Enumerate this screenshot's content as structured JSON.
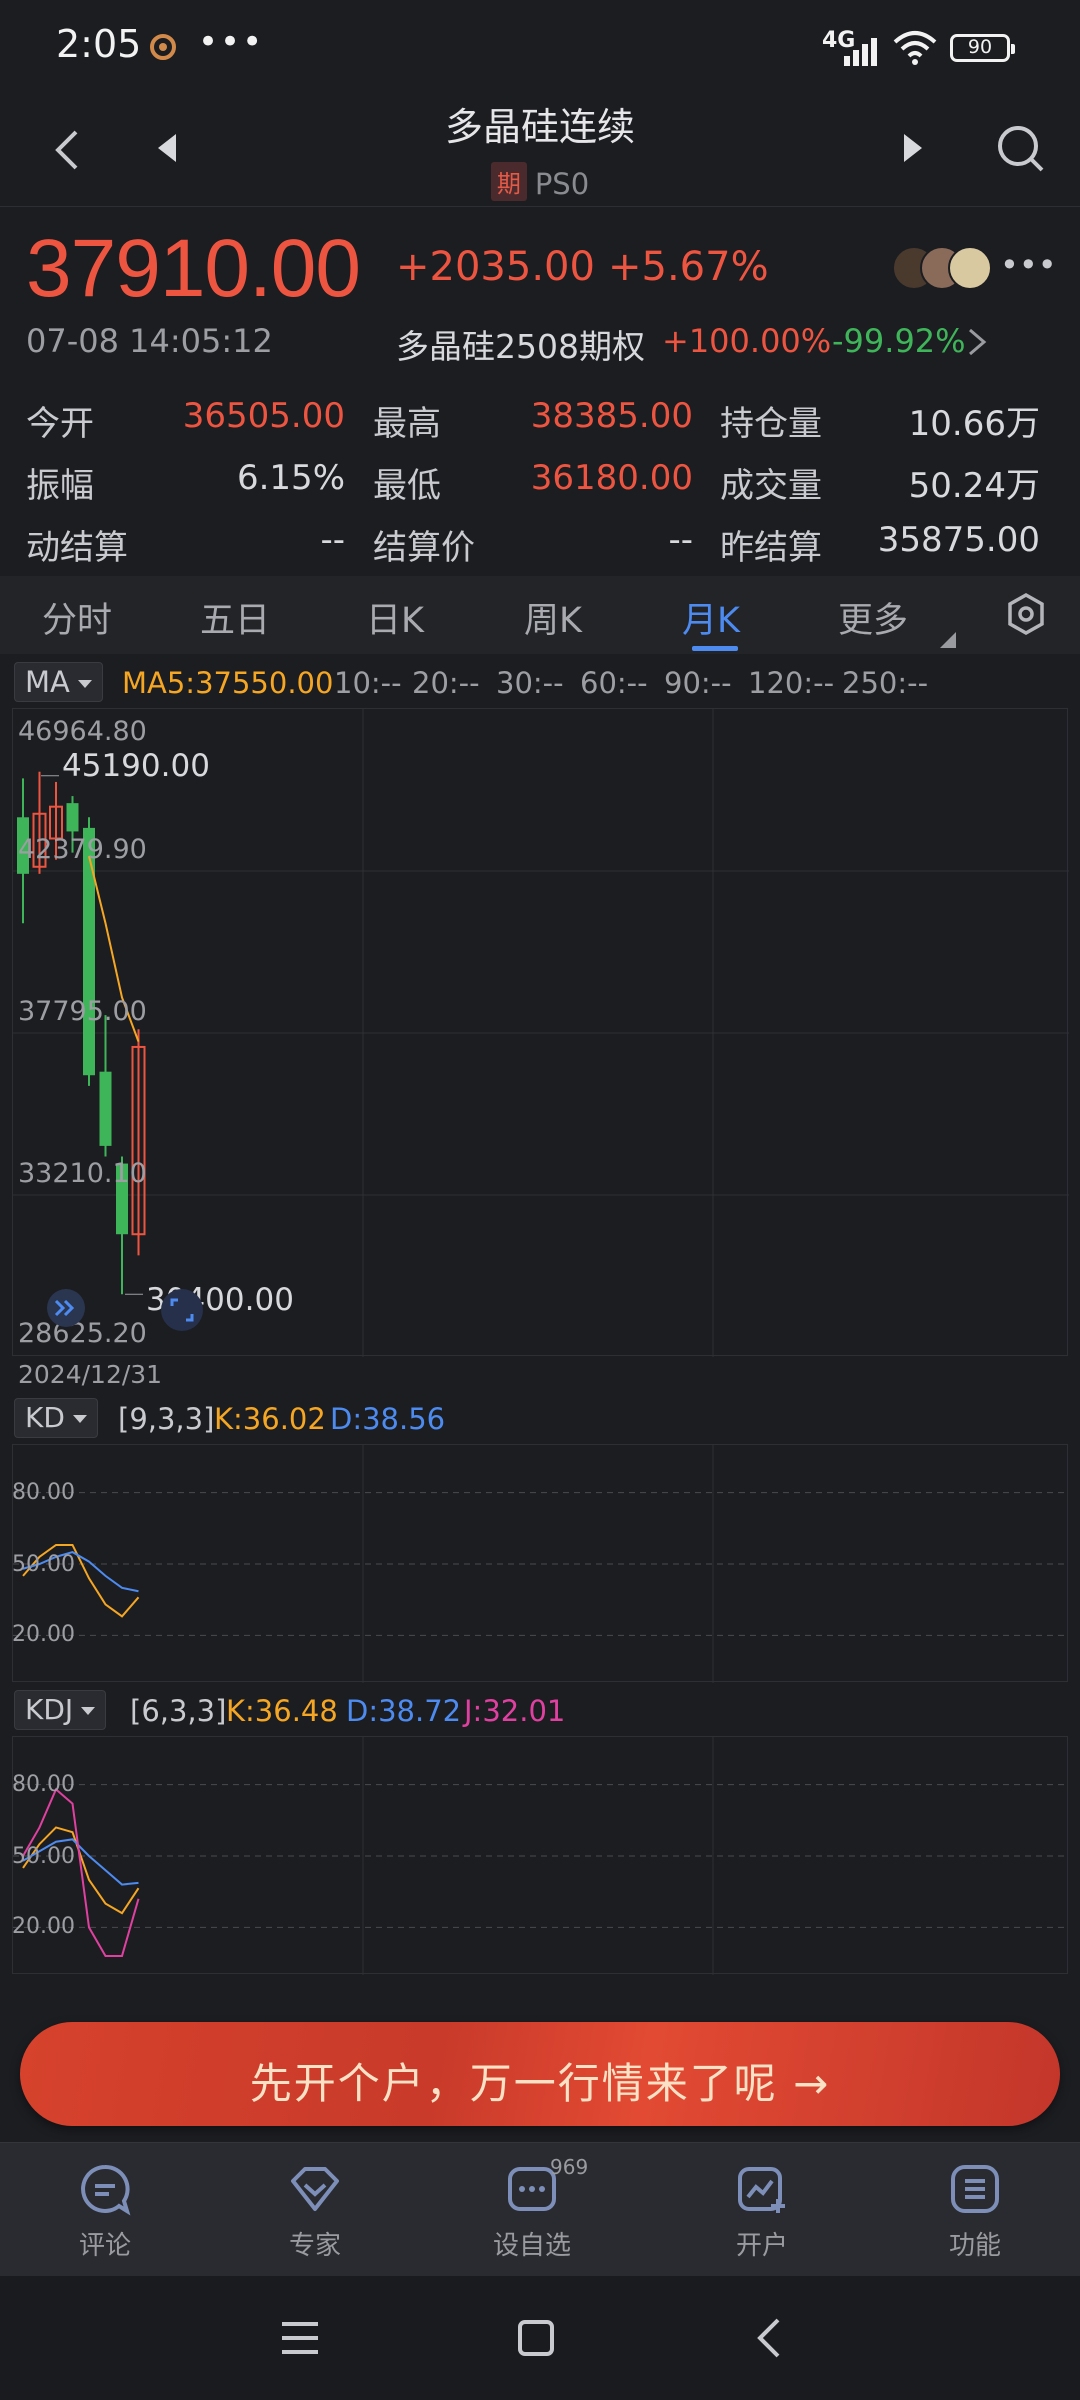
{
  "status_bar": {
    "time": "2:05",
    "dots": "•••",
    "signal": "4G",
    "battery": "90"
  },
  "header": {
    "title": "多晶硅连续",
    "badge": "期",
    "code": "PS0"
  },
  "quote": {
    "price": "37910.00",
    "change": "+2035.00",
    "change_pct": "+5.67%",
    "timestamp": "07-08 14:05:12",
    "option_name": "多晶硅2508期权",
    "option_up": "+100.00%",
    "option_down": "-99.92%"
  },
  "stats": [
    {
      "label": "今开",
      "value": "36505.00",
      "color": "#ee5541"
    },
    {
      "label": "最高",
      "value": "38385.00",
      "color": "#ee5541"
    },
    {
      "label": "持仓量",
      "value": "10.66万",
      "color": "#d8d9dd"
    },
    {
      "label": "振幅",
      "value": "6.15%",
      "color": "#d8d9dd"
    },
    {
      "label": "最低",
      "value": "36180.00",
      "color": "#ee5541"
    },
    {
      "label": "成交量",
      "value": "50.24万",
      "color": "#d8d9dd"
    },
    {
      "label": "动结算",
      "value": "--",
      "color": "#d8d9dd"
    },
    {
      "label": "结算价",
      "value": "--",
      "color": "#d8d9dd"
    },
    {
      "label": "昨结算",
      "value": "35875.00",
      "color": "#d8d9dd"
    }
  ],
  "tabs": [
    "分时",
    "五日",
    "日K",
    "周K",
    "月K",
    "更多"
  ],
  "active_tab": "月K",
  "ma_bar": {
    "selector": "MA",
    "ma5": "MA5:37550.00",
    "others": [
      "10:--",
      "20:--",
      "30:--",
      "60:--",
      "90:--",
      "120:--",
      "250:--"
    ]
  },
  "chart_data": [
    {
      "type": "candlestick",
      "title": "",
      "axis_labels": [
        "46964.80",
        "42379.90",
        "37795.00",
        "33210.10",
        "28625.20"
      ],
      "ylim": [
        28625.2,
        46964.8
      ],
      "start_date": "2024/12/31",
      "max_marker": "45190.00",
      "min_marker": "30400.00",
      "candles": [
        {
          "open": 42300,
          "close": 43900,
          "high": 45000,
          "low": 40900,
          "dir": "down"
        },
        {
          "open": 42500,
          "close": 44000,
          "high": 45190,
          "low": 42300,
          "dir": "up"
        },
        {
          "open": 43300,
          "close": 44200,
          "high": 44900,
          "low": 42700,
          "dir": "up"
        },
        {
          "open": 44300,
          "close": 43500,
          "high": 44500,
          "low": 42900,
          "dir": "down"
        },
        {
          "open": 43600,
          "close": 36600,
          "high": 43900,
          "low": 36300,
          "dir": "down"
        },
        {
          "open": 36700,
          "close": 34600,
          "high": 38300,
          "low": 34300,
          "dir": "down"
        },
        {
          "open": 34100,
          "close": 32100,
          "high": 34300,
          "low": 30400,
          "dir": "down"
        },
        {
          "open": 32100,
          "close": 37400,
          "high": 37900,
          "low": 31500,
          "dir": "up"
        }
      ],
      "ma5": [
        null,
        null,
        null,
        null,
        42800,
        40900,
        38800,
        37550
      ]
    },
    {
      "type": "line",
      "title": "KD",
      "params": "[9,3,3]",
      "legend": {
        "k": "K:36.02",
        "d": "D:38.56"
      },
      "axis_labels": [
        "80.00",
        "50.00",
        "20.00"
      ],
      "ylim": [
        0,
        100
      ],
      "series": [
        {
          "name": "K",
          "color": "#f5a623",
          "values": [
            45,
            53,
            58,
            58,
            44,
            33,
            28,
            36
          ]
        },
        {
          "name": "D",
          "color": "#4d8bf0",
          "values": [
            48,
            50,
            53,
            55,
            51,
            45,
            40,
            38.56
          ]
        }
      ]
    },
    {
      "type": "line",
      "title": "KDJ",
      "params": "[6,3,3]",
      "legend": {
        "k": "K:36.48",
        "d": "D:38.72",
        "j": "J:32.01"
      },
      "axis_labels": [
        "80.00",
        "50.00",
        "20.00"
      ],
      "ylim": [
        0,
        100
      ],
      "series": [
        {
          "name": "K",
          "color": "#f5a623",
          "values": [
            45,
            55,
            62,
            60,
            40,
            30,
            26,
            36.48
          ]
        },
        {
          "name": "D",
          "color": "#4d8bf0",
          "values": [
            48,
            52,
            56,
            57,
            50,
            44,
            38,
            38.72
          ]
        },
        {
          "name": "J",
          "color": "#e040a0",
          "values": [
            50,
            62,
            78,
            72,
            20,
            8,
            8,
            32.01
          ]
        }
      ]
    }
  ],
  "cta": {
    "label": "先开个户，万一行情来了呢 →"
  },
  "bottom_nav": [
    {
      "label": "评论",
      "icon": "comment-icon"
    },
    {
      "label": "专家",
      "icon": "expert-icon"
    },
    {
      "label": "设自选",
      "icon": "watchlist-icon",
      "badge": "969"
    },
    {
      "label": "开户",
      "icon": "open-account-icon"
    },
    {
      "label": "功能",
      "icon": "functions-icon"
    }
  ]
}
